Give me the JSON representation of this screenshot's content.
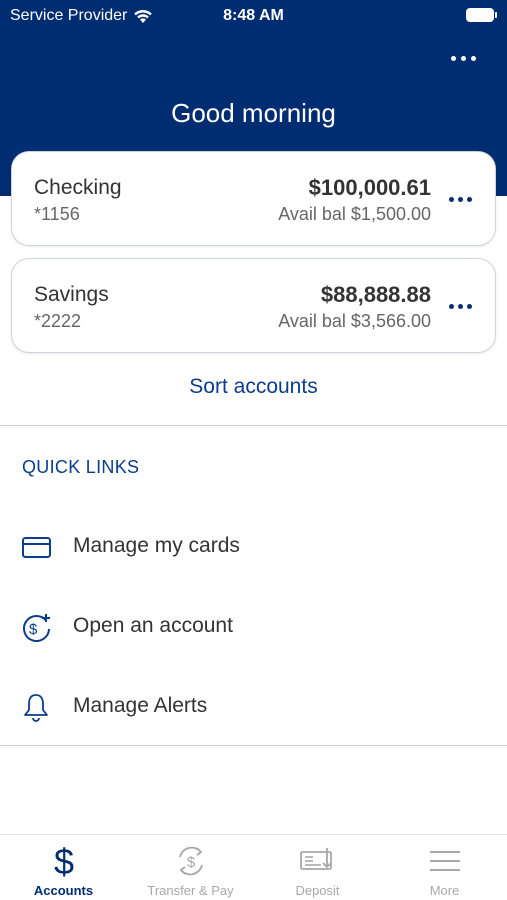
{
  "status_bar": {
    "carrier": "Service Provider",
    "time": "8:48 AM"
  },
  "header": {
    "greeting": "Good morning",
    "menu_icon": "more-horizontal-icon"
  },
  "accounts": [
    {
      "name": "Checking",
      "number": "*1156",
      "balance": "$100,000.61",
      "avail_label": "Avail bal",
      "avail_value": "$1,500.00"
    },
    {
      "name": "Savings",
      "number": "*2222",
      "balance": "$88,888.88",
      "avail_label": "Avail bal",
      "avail_value": "$3,566.00"
    }
  ],
  "sort_label": "Sort accounts",
  "quick_links": {
    "heading": "QUICK LINKS",
    "items": [
      {
        "label": "Manage my cards",
        "icon": "credit-card-icon"
      },
      {
        "label": "Open an account",
        "icon": "dollar-plus-icon"
      },
      {
        "label": "Manage Alerts",
        "icon": "bell-icon"
      }
    ]
  },
  "tabs": [
    {
      "label": "Accounts",
      "icon": "dollar-icon",
      "active": true
    },
    {
      "label": "Transfer & Pay",
      "icon": "transfer-dollar-icon",
      "active": false
    },
    {
      "label": "Deposit",
      "icon": "check-deposit-icon",
      "active": false
    },
    {
      "label": "More",
      "icon": "hamburger-menu-icon",
      "active": false
    }
  ],
  "colors": {
    "brand_navy": "#002d72",
    "link_blue": "#0a3d8c",
    "tab_inactive": "#a8a8a8"
  }
}
